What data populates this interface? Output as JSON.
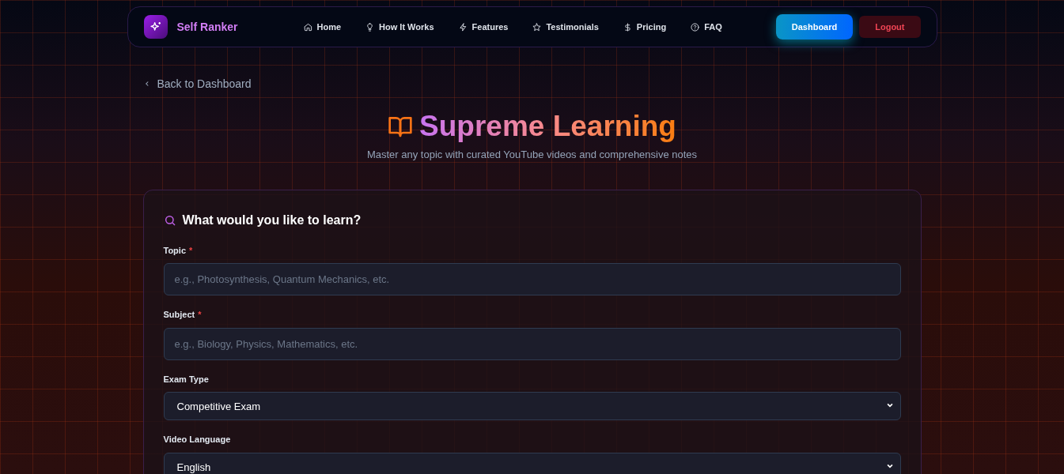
{
  "brand": {
    "name": "Self Ranker"
  },
  "nav": [
    {
      "label": "Home"
    },
    {
      "label": "How It Works"
    },
    {
      "label": "Features"
    },
    {
      "label": "Testimonials"
    },
    {
      "label": "Pricing"
    },
    {
      "label": "FAQ"
    }
  ],
  "actions": [
    {
      "label": "Dashboard",
      "kind": "primary"
    },
    {
      "label": "Logout",
      "kind": "danger"
    }
  ],
  "back_link": "Back to Dashboard",
  "hero": {
    "title": "Supreme Learning",
    "subtitle": "Master any topic with curated YouTube videos and comprehensive notes"
  },
  "form": {
    "title": "What would you like to learn?",
    "fields": [
      {
        "label": "Topic",
        "required_mark": "*",
        "kind": "input",
        "placeholder": "e.g., Photosynthesis, Quantum Mechanics, etc."
      },
      {
        "label": "Subject",
        "required_mark": "*",
        "kind": "input",
        "placeholder": "e.g., Biology, Physics, Mathematics, etc."
      },
      {
        "label": "Exam Type",
        "kind": "select",
        "value": "Competitive Exam"
      },
      {
        "label": "Video Language",
        "kind": "select",
        "value": "English"
      }
    ]
  }
}
